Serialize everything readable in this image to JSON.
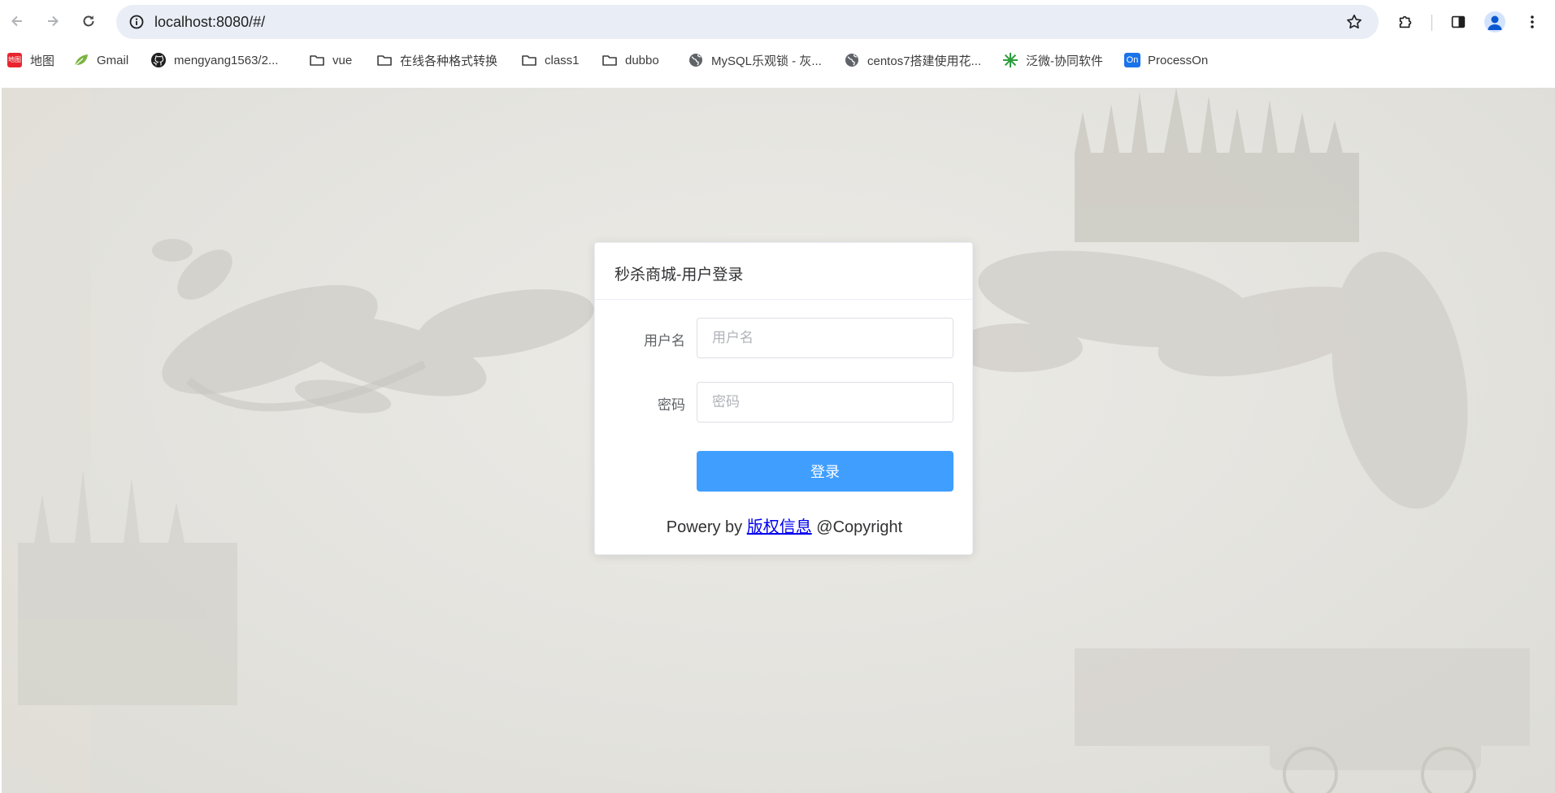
{
  "browser": {
    "url": "localhost:8080/#/",
    "bookmarks": [
      {
        "icon": "map-app-icon",
        "label": "地图"
      },
      {
        "icon": "leaf-icon",
        "label": "Gmail"
      },
      {
        "icon": "github-icon",
        "label": "mengyang1563/2..."
      },
      {
        "icon": "folder-icon",
        "label": "vue"
      },
      {
        "icon": "folder-icon",
        "label": "在线各种格式转换"
      },
      {
        "icon": "folder-icon",
        "label": "class1"
      },
      {
        "icon": "folder-icon",
        "label": "dubbo"
      },
      {
        "icon": "globe-icon",
        "label": "MySQL乐观锁 - 灰..."
      },
      {
        "icon": "globe-icon",
        "label": "centos7搭建使用花..."
      },
      {
        "icon": "fanwei-icon",
        "label": "泛微-协同软件"
      },
      {
        "icon": "processon-icon",
        "label": "ProcessOn"
      }
    ],
    "map_icon_text": "地图",
    "processon_icon_text": "On"
  },
  "login": {
    "title": "秒杀商城-用户登录",
    "username_label": "用户名",
    "username_placeholder": "用户名",
    "username_value": "",
    "password_label": "密码",
    "password_placeholder": "密码",
    "password_value": "",
    "submit_label": "登录",
    "footer_prefix": "Powery by ",
    "footer_link": "版权信息",
    "footer_suffix": " @Copyright"
  },
  "colors": {
    "primary": "#409eff",
    "omnibox": "#e9edf6",
    "link": "#0000ee",
    "background": "#e6e5e0"
  }
}
